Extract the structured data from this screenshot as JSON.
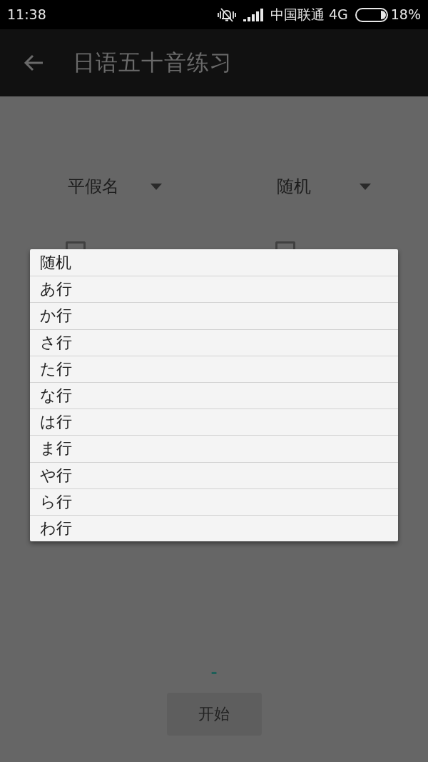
{
  "status_bar": {
    "time": "11:38",
    "carrier": "中国联通 4G",
    "battery": "18%"
  },
  "app_bar": {
    "title": "日语五十音练习"
  },
  "spinners": [
    {
      "value": "平假名"
    },
    {
      "value": "随机"
    }
  ],
  "checkboxes": [
    {
      "checked": false
    },
    {
      "checked": false
    }
  ],
  "dropdown": {
    "items": [
      "随机",
      "あ行",
      "か行",
      "さ行",
      "た行",
      "な行",
      "は行",
      "ま行",
      "や行",
      "ら行",
      "わ行"
    ]
  },
  "result": "-",
  "start_button": {
    "label": "开始"
  }
}
